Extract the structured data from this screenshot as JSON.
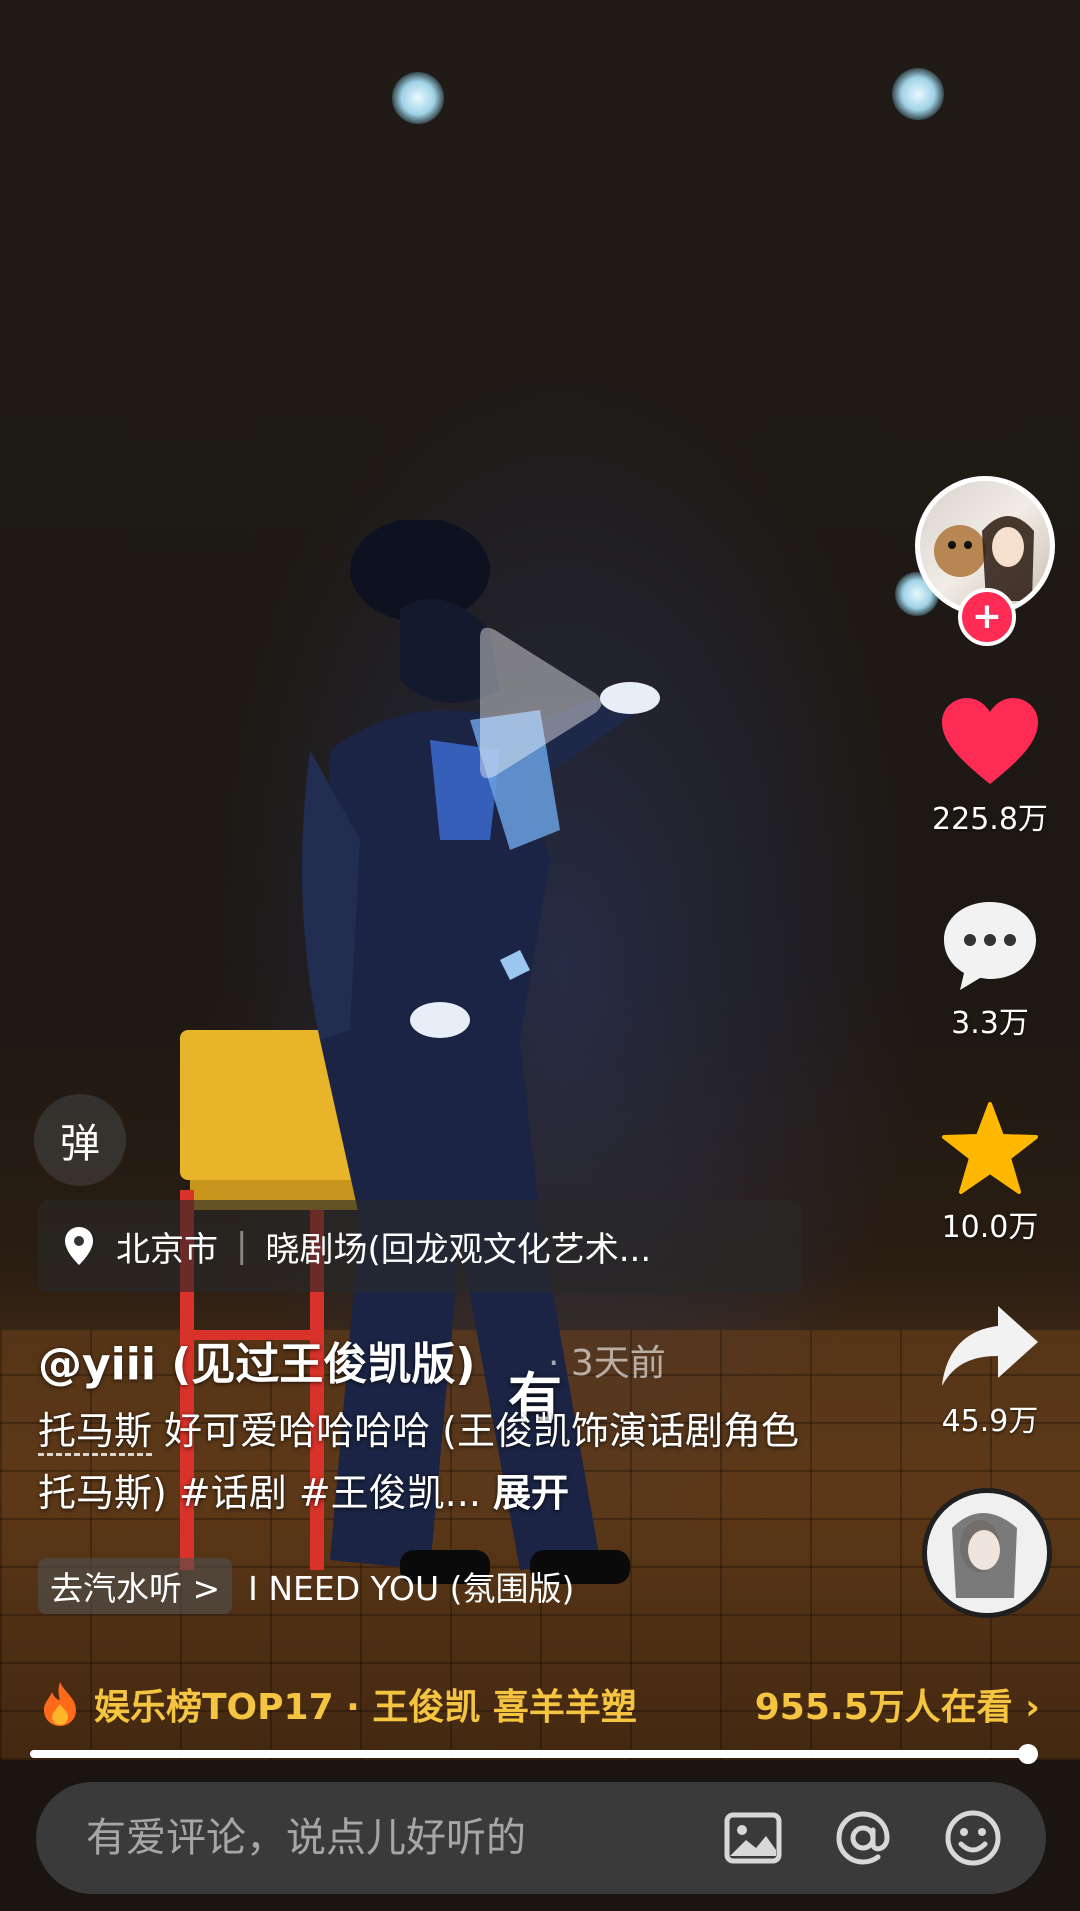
{
  "video": {
    "scene": "stage-performance"
  },
  "sidebar": {
    "follow_label": "+",
    "likes": "225.8万",
    "comments": "3.3万",
    "favorites": "10.0万",
    "shares": "45.9万",
    "like_color": "#fe2c55",
    "favorite_color": "#ffb800"
  },
  "overlay": {
    "danmu_label": "弹",
    "location": {
      "city": "北京市",
      "separator": "|",
      "venue": "晓剧场(回龙观文化艺术..."
    },
    "username": "@yiii (见过王俊凯版)",
    "time": "· 3天前",
    "floating_text": "有",
    "description": {
      "keyword": "托马斯",
      "text": " 好可爱哈哈哈哈 (王俊凯饰演话剧角色托马斯) #话剧 #王俊凯... ",
      "expand": "展开"
    },
    "music": {
      "go_label": "去汽水听 >",
      "song": "I NEED YOU (氛围版)"
    },
    "hot": {
      "rank": "娱乐榜TOP17 · 王俊凯 喜羊羊塑",
      "watching": "955.5万人在看 ›"
    }
  },
  "progress": {
    "fraction": 1.0
  },
  "comment_bar": {
    "placeholder": "有爱评论，说点儿好听的"
  }
}
